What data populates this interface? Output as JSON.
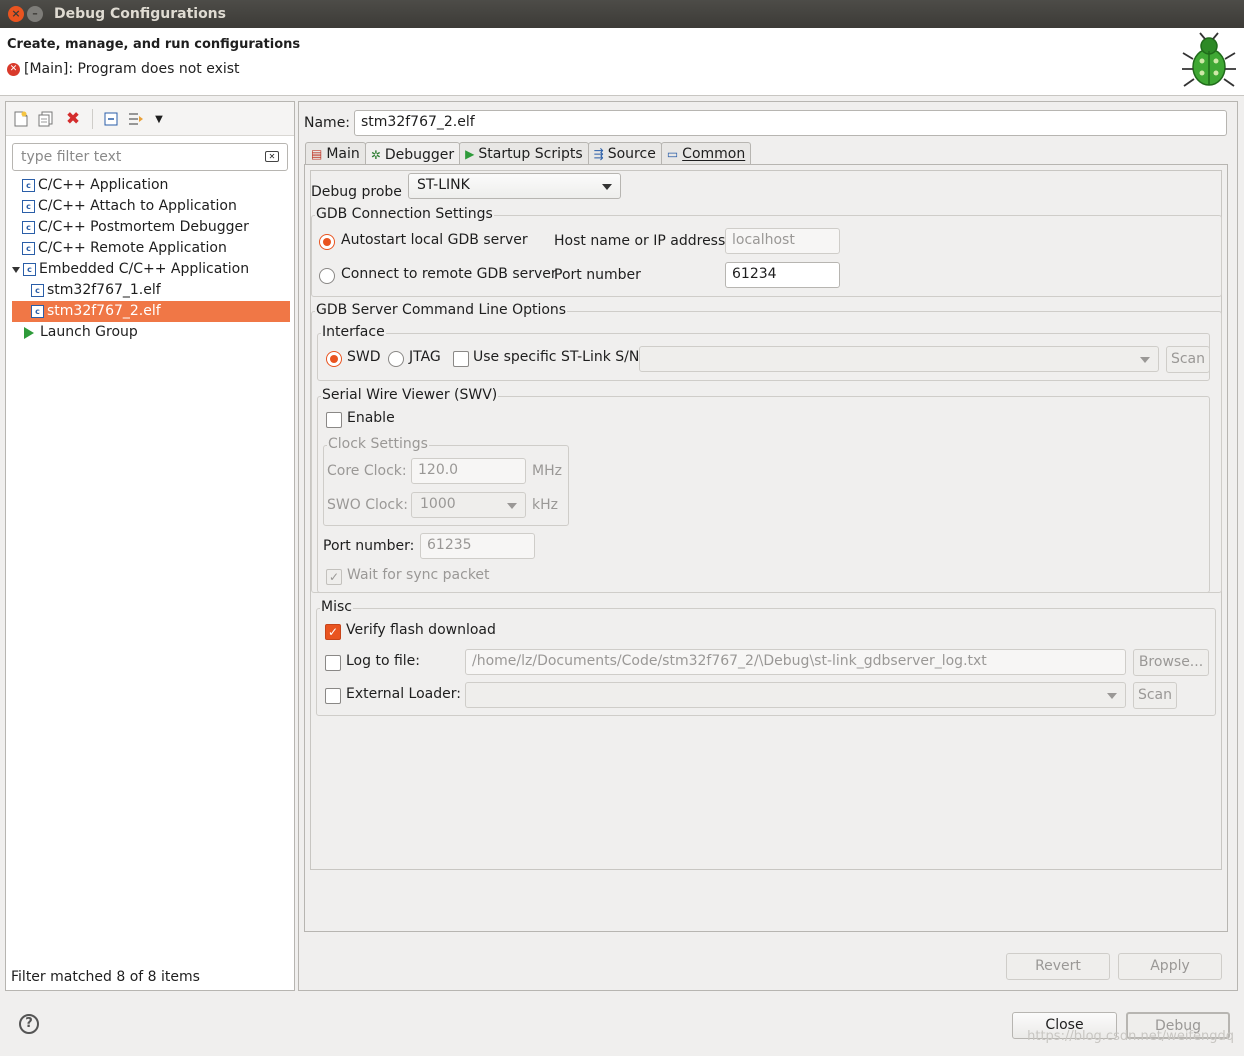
{
  "window": {
    "title": "Debug Configurations"
  },
  "header": {
    "title": "Create, manage, and run configurations",
    "error": "[Main]: Program does not exist"
  },
  "left": {
    "filter_placeholder": "type filter text",
    "tree": [
      {
        "label": "C/C++ Application",
        "icon": "c-app-icon"
      },
      {
        "label": "C/C++ Attach to Application",
        "icon": "c-app-icon"
      },
      {
        "label": "C/C++ Postmortem Debugger",
        "icon": "c-app-icon"
      },
      {
        "label": "C/C++ Remote Application",
        "icon": "c-app-icon"
      },
      {
        "label": "Embedded C/C++ Application",
        "icon": "c-app-icon",
        "expanded": true
      },
      {
        "label": "stm32f767_1.elf",
        "icon": "c-app-icon"
      },
      {
        "label": "stm32f767_2.elf",
        "icon": "c-app-icon",
        "selected": true
      },
      {
        "label": "Launch Group",
        "icon": "launch-icon"
      }
    ],
    "status": "Filter matched 8 of 8 items"
  },
  "right": {
    "name_label": "Name:",
    "name_value": "stm32f767_2.elf",
    "tabs": [
      {
        "label": "Main",
        "icon": "main-tab-icon"
      },
      {
        "label": "Debugger",
        "icon": "debugger-tab-icon",
        "active": true
      },
      {
        "label": "Startup Scripts",
        "icon": "startup-tab-icon"
      },
      {
        "label": "Source",
        "icon": "source-tab-icon"
      },
      {
        "label": "Common",
        "icon": "common-tab-icon"
      }
    ],
    "debug_probe_label": "Debug probe",
    "debug_probe_value": "ST-LINK",
    "gdb_conn": {
      "title": "GDB Connection Settings",
      "autostart": "Autostart local GDB server",
      "remote": "Connect to remote GDB server",
      "host_label": "Host name or IP address",
      "host_value": "localhost",
      "port_label": "Port number",
      "port_value": "61234"
    },
    "gdb_server": {
      "title": "GDB Server Command Line Options",
      "interface_title": "Interface",
      "swd": "SWD",
      "jtag": "JTAG",
      "specific": "Use specific ST-Link S/N",
      "scan": "Scan",
      "swv_title": "Serial Wire Viewer (SWV)",
      "enable": "Enable",
      "clock_title": "Clock Settings",
      "core_clock_label": "Core Clock:",
      "core_clock_value": "120.0",
      "core_clock_unit": "MHz",
      "swo_clock_label": "SWO Clock:",
      "swo_clock_value": "1000",
      "swo_clock_unit": "kHz",
      "port_label": "Port number:",
      "port_value": "61235",
      "wait_sync": "Wait for sync packet",
      "misc_title": "Misc",
      "verify_flash": "Verify flash download",
      "log_to_file": "Log to file:",
      "log_path": "/home/lz/Documents/Code/stm32f767_2/\\Debug\\st-link_gdbserver_log.txt",
      "browse": "Browse...",
      "external_loader": "External Loader:",
      "scan2": "Scan"
    },
    "revert": "Revert",
    "apply": "Apply"
  },
  "footer": {
    "close": "Close",
    "debug": "Debug",
    "watermark": "https://blog.csdn.net/weifengdq"
  },
  "colors": {
    "accent": "#e95420",
    "selection": "#f07746"
  }
}
